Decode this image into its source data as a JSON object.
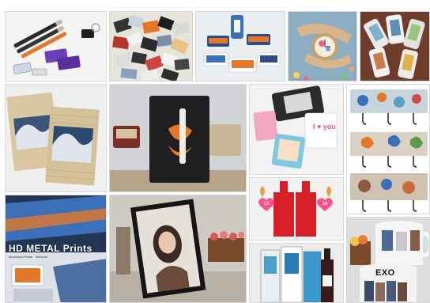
{
  "collage": {
    "background": "#ffffff",
    "tiles": [
      {
        "name": "pens-keychains",
        "subject": "pens-keychains-usb-icon"
      },
      {
        "name": "playing-cards",
        "subject": "card-stack-icon"
      },
      {
        "name": "phone-cases-boxes",
        "subject": "phone-case-icon"
      },
      {
        "name": "watch",
        "subject": "watch-icon"
      },
      {
        "name": "phone-cases-fan",
        "subject": "phone-case-icon"
      },
      {
        "name": "bamboo-blinds-wave",
        "subject": "wave-print-icon"
      },
      {
        "name": "slate-plaque-lips",
        "subject": "lips-print-icon"
      },
      {
        "name": "card-boxes",
        "subject": "card-box-icon"
      },
      {
        "name": "key-hooks-butterflies",
        "subject": "hook-rack-icon"
      },
      {
        "name": "red-vases",
        "subject": "vase-icon"
      },
      {
        "name": "hd-metal-prints",
        "subject": "metal-panel-icon"
      },
      {
        "name": "photo-frame-portrait",
        "subject": "portrait-frame-icon"
      },
      {
        "name": "boxed-bottles",
        "subject": "bottle-box-icon"
      },
      {
        "name": "photo-mugs",
        "subject": "mug-icon"
      }
    ]
  },
  "text": {
    "metal_banner_title": "HD METAL Prints",
    "metal_banner_sub": "Aluminium Photo · Metal Art",
    "card_box_text": "I ♥ you",
    "vase_heart_left": "13",
    "vase_heart_right": "14",
    "mug_text": "EXO"
  },
  "colors": {
    "accent_orange": "#e3782a",
    "vase_red": "#d61f26",
    "slate": "#1f1f22",
    "blue_steel": "#3b6fb8"
  }
}
